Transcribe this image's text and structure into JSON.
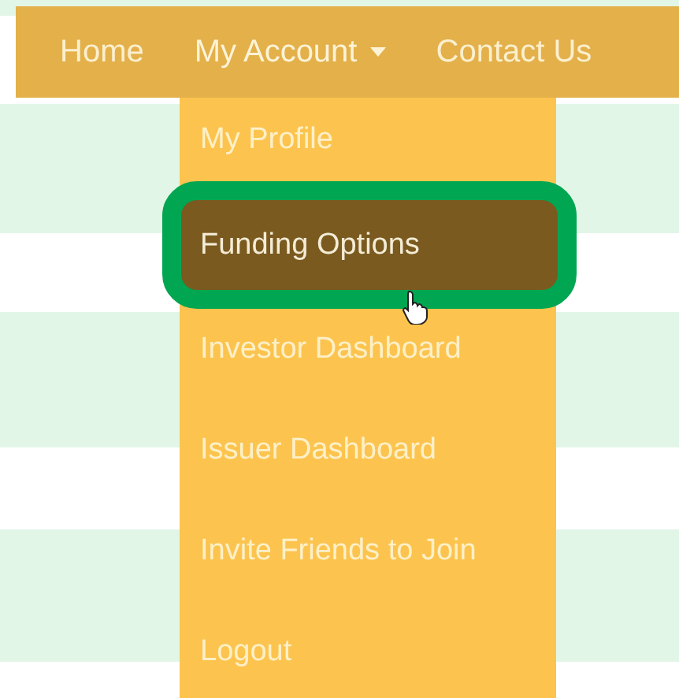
{
  "nav": [
    {
      "label": "Home",
      "has_caret": false,
      "expanded": false
    },
    {
      "label": "My Account",
      "has_caret": true,
      "expanded": true
    },
    {
      "label": "Contact Us",
      "has_caret": false,
      "expanded": false
    }
  ],
  "dropdown": [
    {
      "label": "My Profile",
      "selected": false
    },
    {
      "label": "Funding Options",
      "selected": true
    },
    {
      "label": "Investor Dashboard",
      "selected": false
    },
    {
      "label": "Issuer Dashboard",
      "selected": false
    },
    {
      "label": "Invite Friends to Join",
      "selected": false
    },
    {
      "label": "Logout",
      "selected": false
    }
  ]
}
